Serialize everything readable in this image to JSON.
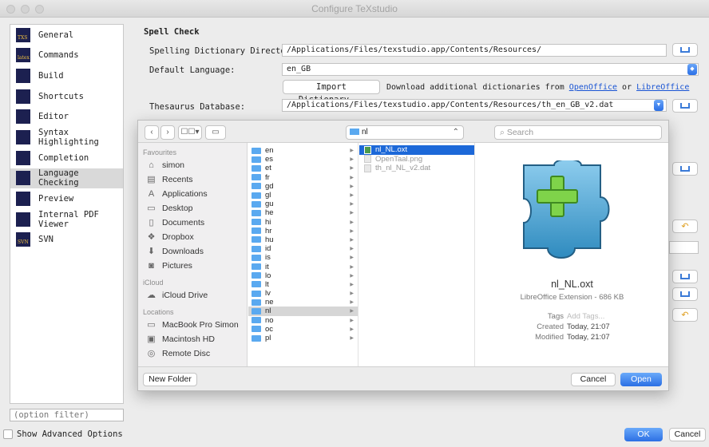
{
  "window": {
    "title": "Configure TeXstudio"
  },
  "sidebar": {
    "items": [
      {
        "label": "General",
        "badge": "TXS"
      },
      {
        "label": "Commands",
        "badge": "latex"
      },
      {
        "label": "Build",
        "badge": ""
      },
      {
        "label": "Shortcuts",
        "badge": ""
      },
      {
        "label": "Editor",
        "badge": ""
      },
      {
        "label": "Syntax Highlighting",
        "badge": ""
      },
      {
        "label": "Completion",
        "badge": ""
      },
      {
        "label": "Language Checking",
        "badge": ""
      },
      {
        "label": "Preview",
        "badge": ""
      },
      {
        "label": "Internal PDF Viewer",
        "badge": ""
      },
      {
        "label": "SVN",
        "badge": "SVN"
      }
    ],
    "selected": "Language Checking",
    "filter_placeholder": "(option filter)",
    "advanced_label": "Show Advanced Options"
  },
  "spell": {
    "section": "Spell Check",
    "dir_label": "Spelling Dictionary Directories:",
    "dir_value": "/Applications/Files/texstudio.app/Contents/Resources/",
    "lang_label": "Default Language:",
    "lang_value": "en_GB",
    "import_btn": "Import Dictionary...",
    "download_text": "Download additional dictionaries from",
    "link_oo": "OpenOffice",
    "or_text": "or",
    "link_lo": "LibreOffice",
    "thes_label": "Thesaurus Database:",
    "thes_value": "/Applications/Files/texstudio.app/Contents/Resources/th_en_GB_v2.dat"
  },
  "footer": {
    "ok": "OK",
    "cancel": "Cancel"
  },
  "dialog": {
    "view_btn": "☐☐▾",
    "path": "nl",
    "search_placeholder": "Search",
    "favourites_h": "Favourites",
    "favourites": [
      {
        "label": "simon",
        "glyph": "⌂"
      },
      {
        "label": "Recents",
        "glyph": "▤"
      },
      {
        "label": "Applications",
        "glyph": "A"
      },
      {
        "label": "Desktop",
        "glyph": "▭"
      },
      {
        "label": "Documents",
        "glyph": "▯"
      },
      {
        "label": "Dropbox",
        "glyph": "❖"
      },
      {
        "label": "Downloads",
        "glyph": "⬇"
      },
      {
        "label": "Pictures",
        "glyph": "◙"
      }
    ],
    "icloud_h": "iCloud",
    "icloud": [
      {
        "label": "iCloud Drive",
        "glyph": "☁"
      }
    ],
    "locations_h": "Locations",
    "locations": [
      {
        "label": "MacBook Pro Simon",
        "glyph": "▭"
      },
      {
        "label": "Macintosh HD",
        "glyph": "▣"
      },
      {
        "label": "Remote Disc",
        "glyph": "◎"
      }
    ],
    "folders": [
      "en",
      "es",
      "et",
      "fr",
      "gd",
      "gl",
      "gu",
      "he",
      "hi",
      "hr",
      "hu",
      "id",
      "is",
      "it",
      "lo",
      "lt",
      "lv",
      "ne",
      "nl",
      "no",
      "oc",
      "pl"
    ],
    "selected_folder": "nl",
    "files": [
      {
        "name": "nl_NL.oxt",
        "selected": true
      },
      {
        "name": "OpenTaal.png",
        "selected": false
      },
      {
        "name": "th_nl_NL_v2.dat",
        "selected": false
      }
    ],
    "preview": {
      "name": "nl_NL.oxt",
      "kind": "LibreOffice Extension - 686 KB",
      "tags_k": "Tags",
      "tags_v": "Add Tags...",
      "created_k": "Created",
      "created_v": "Today, 21:07",
      "modified_k": "Modified",
      "modified_v": "Today, 21:07"
    },
    "new_folder": "New Folder",
    "cancel": "Cancel",
    "open": "Open"
  }
}
